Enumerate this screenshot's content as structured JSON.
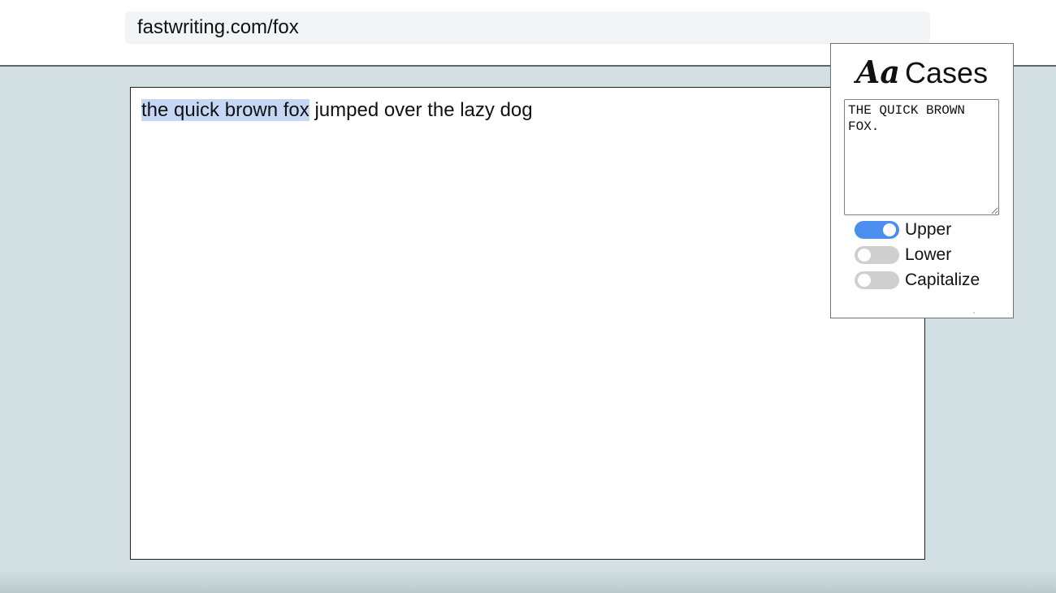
{
  "browser": {
    "url": "fastwriting.com/fox"
  },
  "editor": {
    "selected_text": "the quick brown fox",
    "remaining_text": " jumped over the lazy dog"
  },
  "cases_popup": {
    "logo_text": "Aa",
    "title": "Cases",
    "preview_text": "THE QUICK BROWN FOX.",
    "toggles": [
      {
        "label": "Upper",
        "on": true
      },
      {
        "label": "Lower",
        "on": false
      },
      {
        "label": "Capitalize",
        "on": false
      }
    ]
  },
  "colors": {
    "page_background": "#d2dfe3",
    "toggle_on": "#4a8ff0",
    "toggle_off": "#cfcfcf",
    "selection": "#c6d7f6"
  }
}
